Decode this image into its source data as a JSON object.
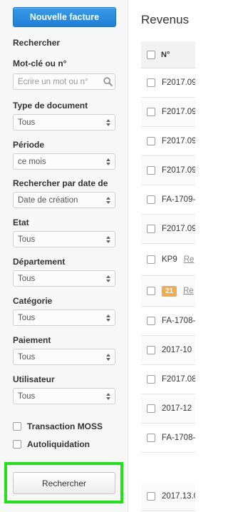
{
  "sidebar": {
    "new_invoice_label": "Nouvelle facture",
    "section_title": "Rechercher",
    "keyword": {
      "label": "Mot-clé ou n°",
      "placeholder": "Ecrire un mot ou n°"
    },
    "doc_type": {
      "label": "Type de document",
      "value": "Tous"
    },
    "period": {
      "label": "Période",
      "value": "ce mois"
    },
    "date_search": {
      "label": "Rechercher par date de",
      "value": "Date de création"
    },
    "state": {
      "label": "Etat",
      "value": "Tous"
    },
    "department": {
      "label": "Département",
      "value": "Tous"
    },
    "category": {
      "label": "Catégorie",
      "value": "Tous"
    },
    "payment": {
      "label": "Paiement",
      "value": "Tous"
    },
    "user": {
      "label": "Utilisateur",
      "value": "Tous"
    },
    "moss_label": "Transaction MOSS",
    "reverse_label": "Autoliquidation",
    "search_button_label": "Rechercher",
    "highlight_color": "#22e01a",
    "accent_color": "#2a8ee0"
  },
  "main": {
    "title": "Revenus",
    "header_no": "N°",
    "rows": [
      {
        "no": "F2017.09"
      },
      {
        "no": "F2017.09"
      },
      {
        "no": "F2017.09"
      },
      {
        "no": "F2017.09"
      },
      {
        "no": "FA-1709-"
      },
      {
        "no": "F2017.09"
      },
      {
        "no": "KP9",
        "link": "Re"
      },
      {
        "badge": "21",
        "link": "Re"
      },
      {
        "no": "FA-1708-"
      },
      {
        "no": "2017-10"
      },
      {
        "no": "F2017.08"
      },
      {
        "no": "2017-12"
      },
      {
        "no": "FA-1708-"
      },
      {
        "no": "2017.13.0"
      }
    ]
  }
}
